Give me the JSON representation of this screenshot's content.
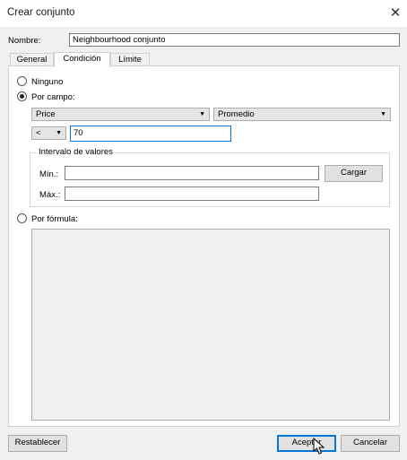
{
  "window": {
    "title": "Crear conjunto"
  },
  "name": {
    "label": "Nombre:",
    "value": "Neighbourhood conjunto"
  },
  "tabs": [
    {
      "label": "General",
      "active": false
    },
    {
      "label": "Condición",
      "active": true
    },
    {
      "label": "Límite",
      "active": false
    }
  ],
  "condition": {
    "none_label": "Ninguno",
    "by_field_label": "Por campo:",
    "field_value": "Price",
    "aggregation_value": "Promedio",
    "operator_value": "<",
    "threshold_value": "70",
    "range": {
      "group_label": "Intervalo de valores",
      "min_label": "Mín.:",
      "max_label": "Máx.:",
      "min_value": "",
      "max_value": "",
      "load_label": "Cargar"
    },
    "by_formula_label": "Por fórmula:",
    "formula_value": ""
  },
  "footer": {
    "reset_label": "Restablecer",
    "ok_label": "Aceptar",
    "cancel_label": "Cancelar"
  }
}
